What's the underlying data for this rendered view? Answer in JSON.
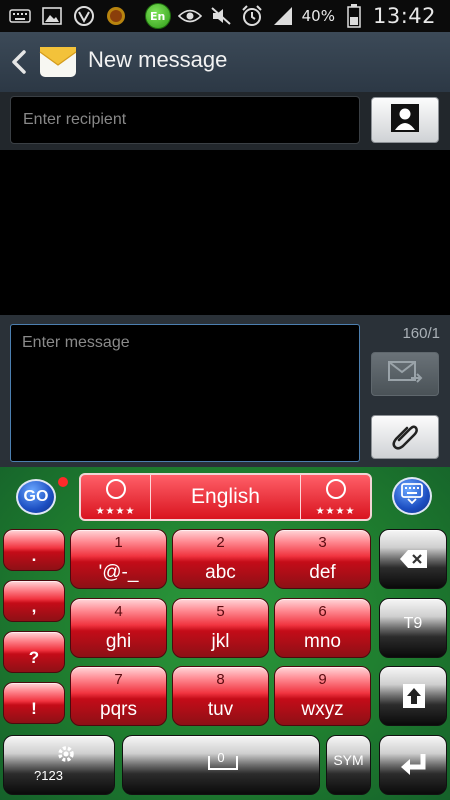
{
  "status_bar": {
    "left_icons": [
      "keyboard-icon",
      "image-icon",
      "vpn-icon",
      "badge-icon"
    ],
    "keyboard_badge": "En",
    "right_icons": [
      "eye-icon",
      "mute-icon",
      "alarm-icon",
      "signal-icon",
      "battery-icon"
    ],
    "battery_percent": "40%",
    "time": "13:42"
  },
  "action_bar": {
    "title": "New message"
  },
  "recipient": {
    "placeholder": "Enter recipient"
  },
  "compose": {
    "placeholder": "Enter message",
    "counter": "160/1"
  },
  "keyboard": {
    "go_label": "GO",
    "language": "English",
    "left_stars": "★★★★",
    "right_stars": "★★★★",
    "side_keys": [
      ".",
      ",",
      "?",
      "!"
    ],
    "keys": [
      {
        "num": "1",
        "letters": "'@-_"
      },
      {
        "num": "2",
        "letters": "abc"
      },
      {
        "num": "3",
        "letters": "def"
      },
      {
        "num": "4",
        "letters": "ghi"
      },
      {
        "num": "5",
        "letters": "jkl"
      },
      {
        "num": "6",
        "letters": "mno"
      },
      {
        "num": "7",
        "letters": "pqrs"
      },
      {
        "num": "8",
        "letters": "tuv"
      },
      {
        "num": "9",
        "letters": "wxyz"
      }
    ],
    "t9_label": "T9",
    "sym_label": "SYM",
    "settings_label": "?123",
    "space_num": "0"
  },
  "colors": {
    "keyboard_green": "#1f7d2f",
    "key_red": "#f13440",
    "action_bar": "#34414e"
  }
}
